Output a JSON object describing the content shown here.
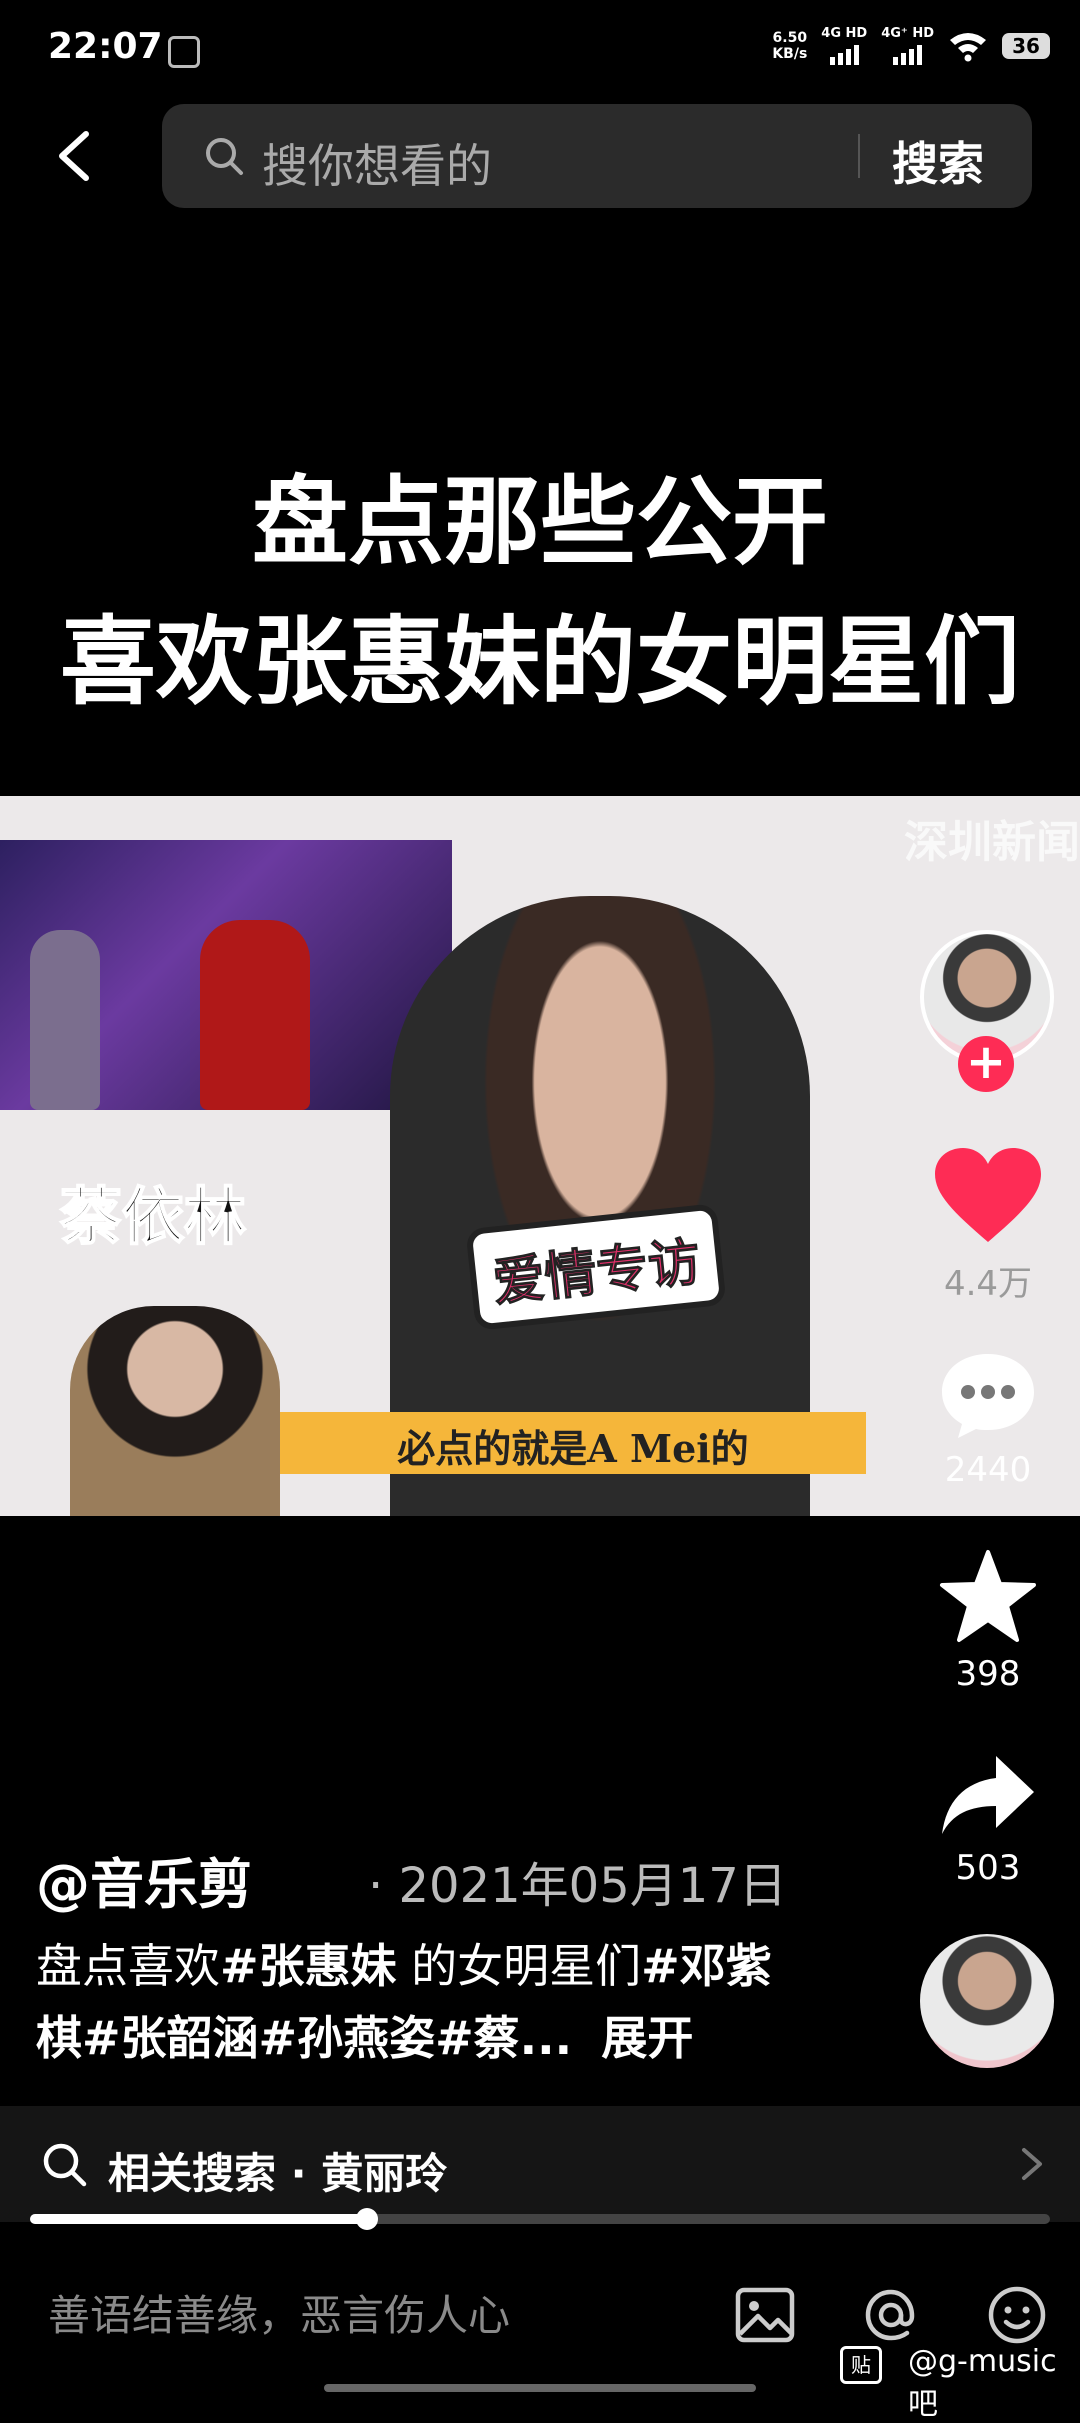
{
  "status_bar": {
    "time": "22:07",
    "net_speed_value": "6.50",
    "net_speed_unit": "KB/s",
    "signal1_label": "4G HD",
    "signal2_label": "4G⁺ HD",
    "battery": "36"
  },
  "search": {
    "placeholder": "搜你想看的",
    "button_label": "搜索"
  },
  "video": {
    "title_line1": "盘点那些公开",
    "title_line2": "喜欢张惠妹的女明星们",
    "name_tag": "蔡依林",
    "logo_text": "爱情专访",
    "subtitle": "必点的就是A Mei的",
    "watermark": "深圳新闻"
  },
  "rail": {
    "likes": "4.4万",
    "comments": "2440",
    "favorites": "398",
    "shares": "503"
  },
  "post": {
    "author": "@音乐剪",
    "date": "2021年05月17日",
    "desc_plain1": "盘点喜欢",
    "desc_tag1": "#张惠妹",
    "desc_plain2": " 的女明星们",
    "desc_tag2": "#邓紫棋#张韶涵#孙燕姿#蔡...",
    "expand": "展开"
  },
  "related": {
    "text": "相关搜索 · 黄丽玲"
  },
  "progress": 0.33,
  "comment_bar": {
    "placeholder": "善语结善缘，恶言伤人心"
  },
  "source": {
    "badge": "贴",
    "watermark": "@g-music吧"
  },
  "colors": {
    "like": "#fe2c55",
    "subtitle_bar": "#f5b63a"
  }
}
